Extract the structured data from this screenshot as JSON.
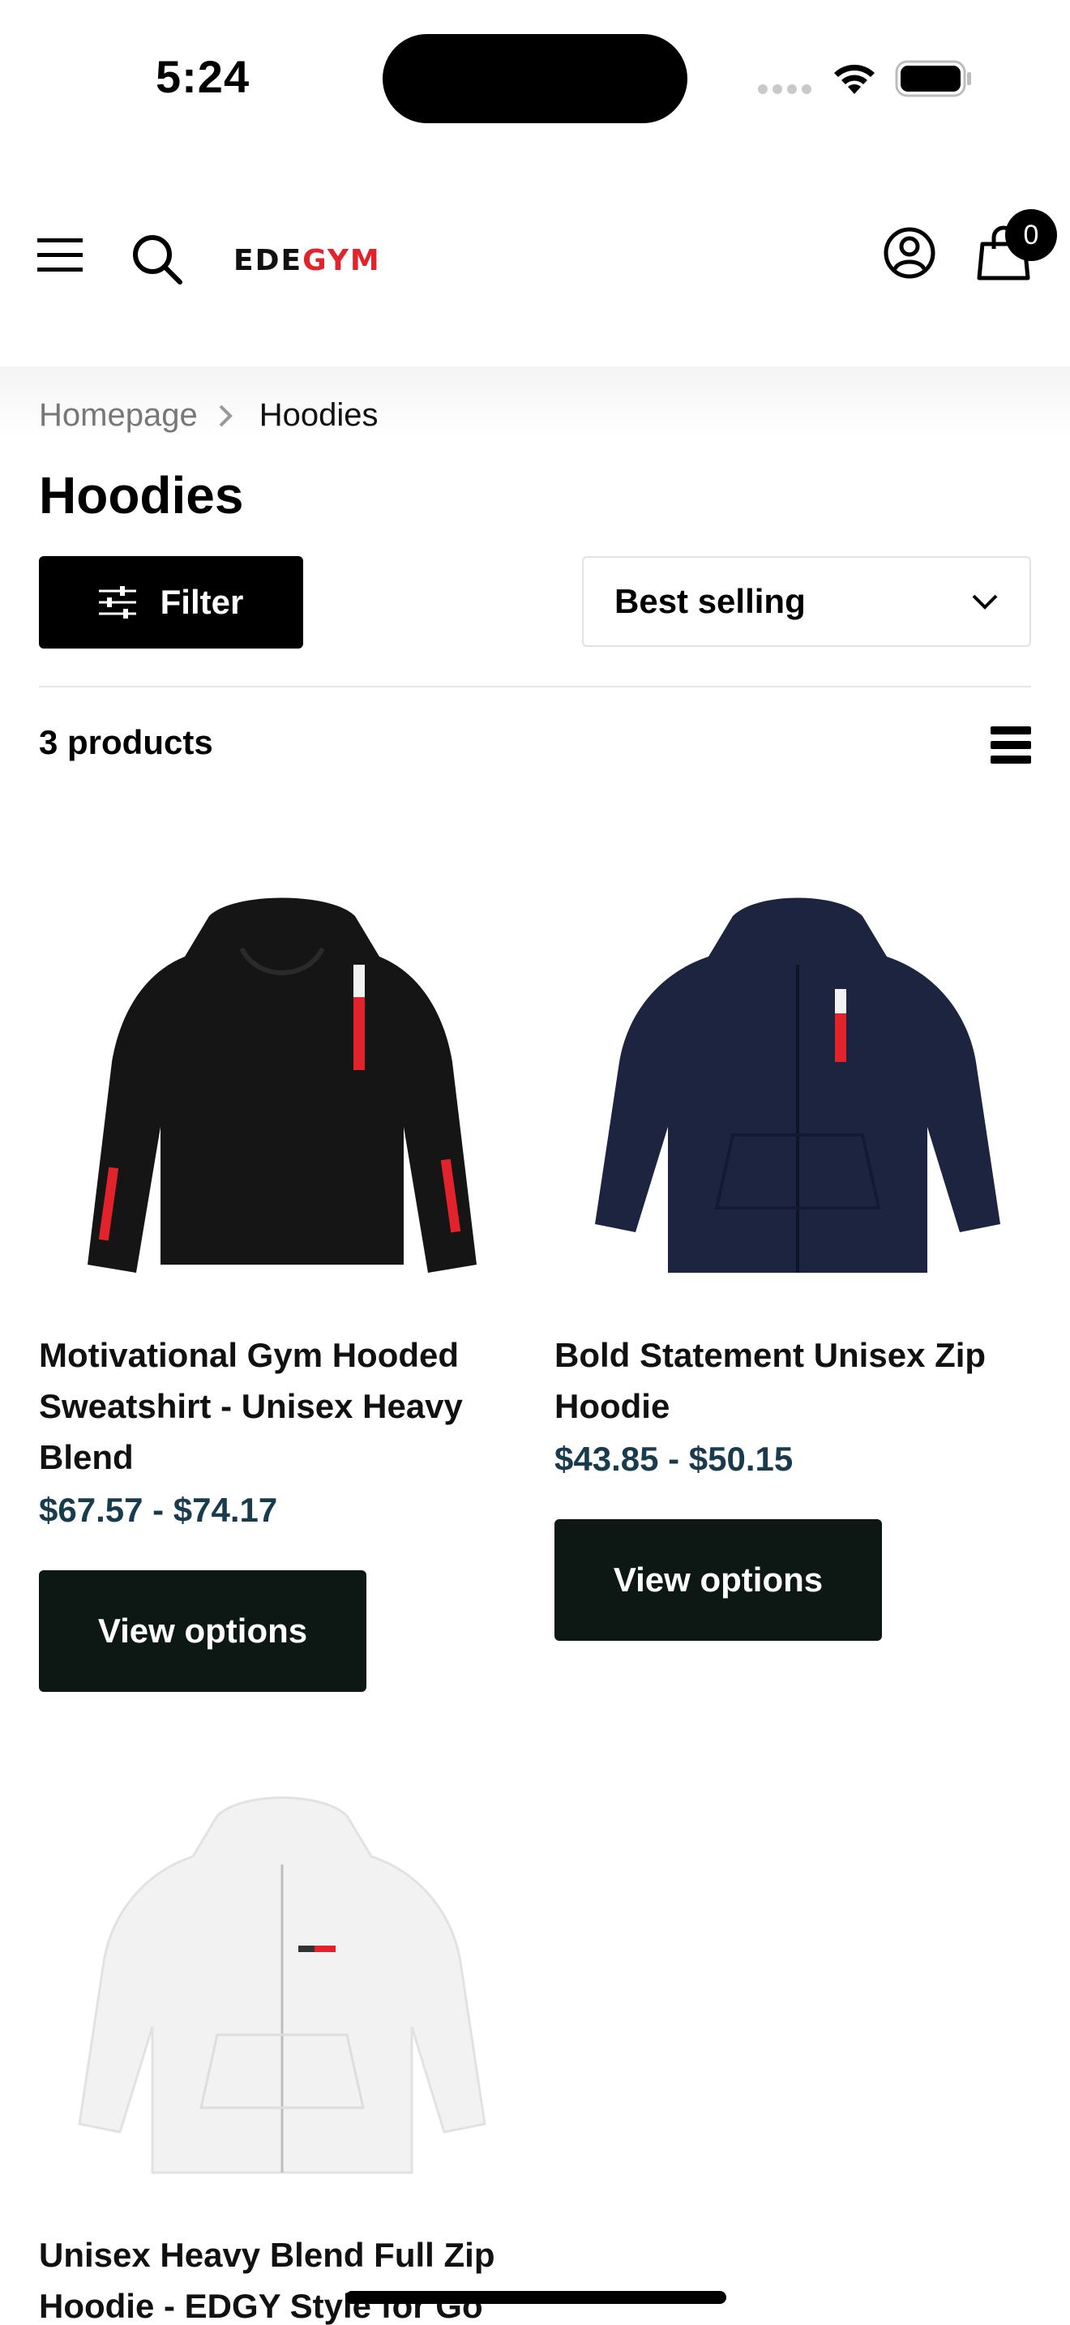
{
  "status_bar": {
    "time": "5:24"
  },
  "header": {
    "logo_part1": "EDE",
    "logo_part2": "GYM",
    "cart_count": "0"
  },
  "breadcrumb": {
    "home": "Homepage",
    "current": "Hoodies"
  },
  "page": {
    "title": "Hoodies",
    "filter_label": "Filter",
    "sort_value": "Best selling",
    "product_count": "3 products"
  },
  "products": [
    {
      "title": "Motivational Gym Hooded Sweatshirt - Unisex Heavy Blend",
      "price": "$67.57 - $74.17",
      "button": "View options",
      "color": "#151515"
    },
    {
      "title": "Bold Statement Unisex Zip Hoodie",
      "price": "$43.85 - $50.15",
      "button": "View options",
      "color": "#1d2440"
    },
    {
      "title": "Unisex Heavy Blend Full Zip Hoodie - EDGY Style for Go",
      "color": "#f2f2f2"
    }
  ],
  "colors": {
    "brand_red": "#e3232c",
    "price": "#183b4e",
    "button_bg": "#0d1714"
  }
}
